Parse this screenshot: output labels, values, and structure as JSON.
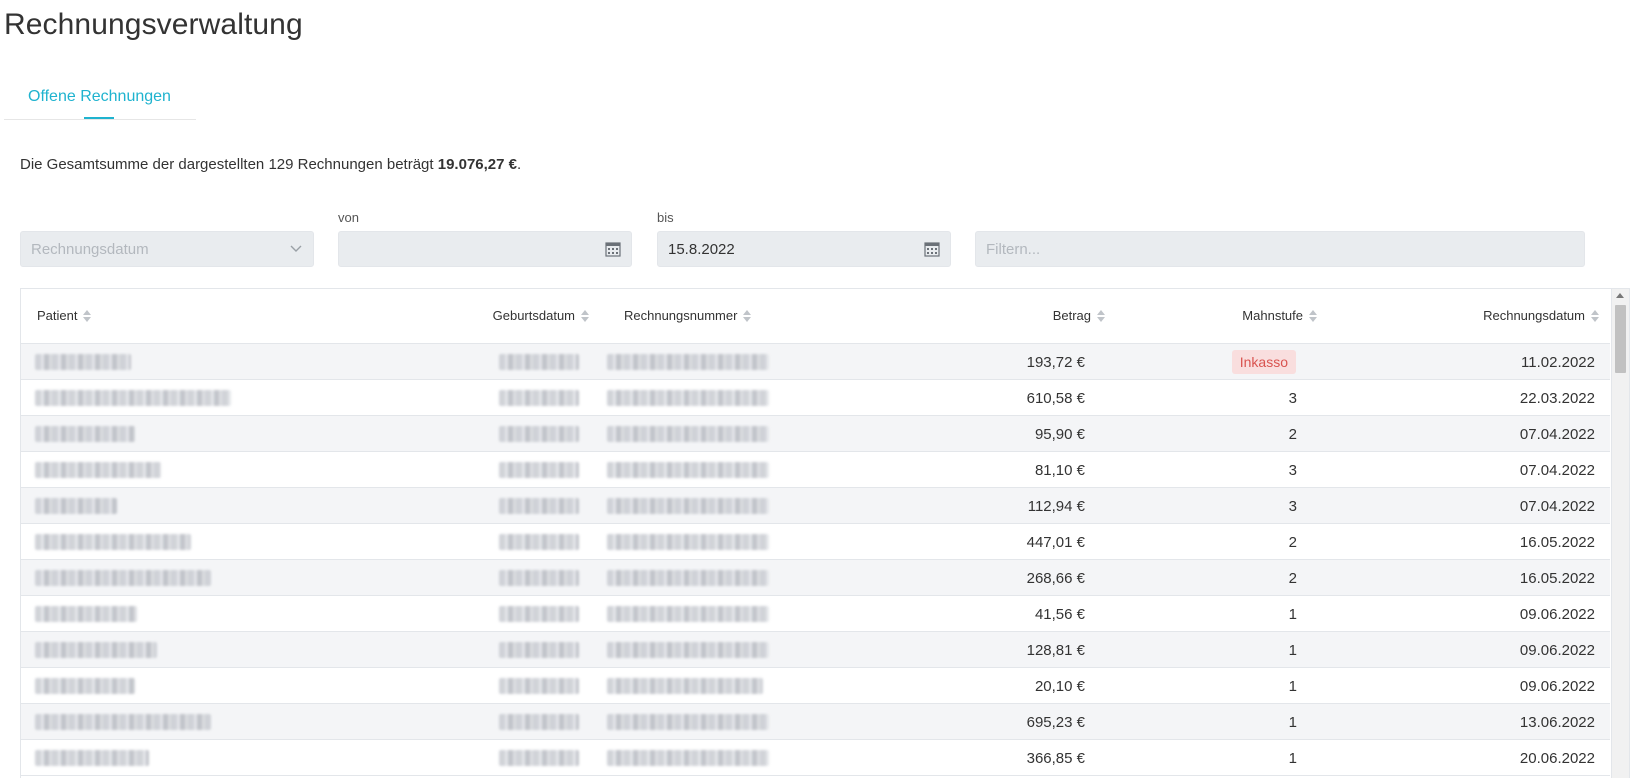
{
  "page": {
    "title": "Rechnungsverwaltung"
  },
  "tabs": [
    {
      "label": "Offene Rechnungen",
      "active": true
    }
  ],
  "summary": {
    "prefix": "Die Gesamtsumme der dargestellten 129 Rechnungen beträgt",
    "total": "19.076,27 €",
    "suffix": "."
  },
  "filters": {
    "date_type": {
      "value": "Rechnungsdatum"
    },
    "from": {
      "label": "von",
      "value": ""
    },
    "to": {
      "label": "bis",
      "value": "15.8.2022"
    },
    "search": {
      "placeholder": "Filtern...",
      "value": ""
    }
  },
  "table": {
    "columns": [
      {
        "key": "patient",
        "label": "Patient"
      },
      {
        "key": "birthdate",
        "label": "Geburtsdatum"
      },
      {
        "key": "invoice_number",
        "label": "Rechnungsnummer"
      },
      {
        "key": "amount",
        "label": "Betrag"
      },
      {
        "key": "dunning_level",
        "label": "Mahnstufe"
      },
      {
        "key": "invoice_date",
        "label": "Rechnungsdatum"
      }
    ],
    "rows": [
      {
        "amount": "193,72 €",
        "dunning_level": "Inkasso",
        "dunning_badge": true,
        "invoice_date": "11.02.2022"
      },
      {
        "amount": "610,58 €",
        "dunning_level": "3",
        "invoice_date": "22.03.2022"
      },
      {
        "amount": "95,90 €",
        "dunning_level": "2",
        "invoice_date": "07.04.2022"
      },
      {
        "amount": "81,10 €",
        "dunning_level": "3",
        "invoice_date": "07.04.2022"
      },
      {
        "amount": "112,94 €",
        "dunning_level": "3",
        "invoice_date": "07.04.2022"
      },
      {
        "amount": "447,01 €",
        "dunning_level": "2",
        "invoice_date": "16.05.2022"
      },
      {
        "amount": "268,66 €",
        "dunning_level": "2",
        "invoice_date": "16.05.2022"
      },
      {
        "amount": "41,56 €",
        "dunning_level": "1",
        "invoice_date": "09.06.2022"
      },
      {
        "amount": "128,81 €",
        "dunning_level": "1",
        "invoice_date": "09.06.2022"
      },
      {
        "amount": "20,10 €",
        "dunning_level": "1",
        "invoice_date": "09.06.2022"
      },
      {
        "amount": "695,23 €",
        "dunning_level": "1",
        "invoice_date": "13.06.2022"
      },
      {
        "amount": "366,85 €",
        "dunning_level": "1",
        "invoice_date": "20.06.2022"
      }
    ]
  },
  "colors": {
    "accent": "#1fb3cf",
    "danger": "#d9534f",
    "danger_bg": "#f9dede",
    "input_bg": "#e9ecef",
    "row_alt": "#f4f5f7"
  },
  "icons": {
    "calendar": "calendar-icon",
    "sort": "sort-icon",
    "dropdown": "chevron-down-icon"
  }
}
